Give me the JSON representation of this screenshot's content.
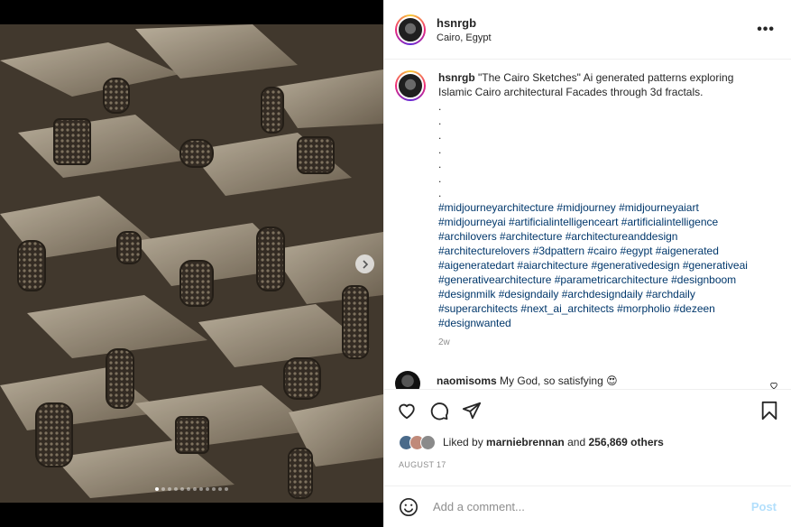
{
  "post": {
    "username": "hsnrgb",
    "location": "Cairo, Egypt",
    "more_icon": "more-horizontal-icon"
  },
  "caption": {
    "username": "hsnrgb",
    "text": "\"The Cairo Sketches\" Ai generated patterns exploring Islamic Cairo architectural Facades through 3d fractals.",
    "dot_lines": [
      ".",
      ".",
      ".",
      ".",
      ".",
      ".",
      "."
    ],
    "hashtags": "#midjourneyarchitecture #midjourney #midjourneyaiart #midjourneyai #artificialintelligenceart #artificialintelligence #archilovers #architecture #architectureanddesign #architecturelovers #3dpattern #cairo #egypt #aigenerated #aigeneratedart #aiarchitecture #generativedesign #generativeai #generativearchitecture #parametricarchitecture #designboom #designmilk #designdaily #archdesigndaily #archdaily #superarchitects #next_ai_architects #morpholio #dezeen #designwanted",
    "time": "2w"
  },
  "comment": {
    "username": "naomisoms",
    "text": "My God, so satisfying 😍"
  },
  "likes": {
    "prefix": "Liked by",
    "user": "marniebrennan",
    "and": "and",
    "others": "256,869 others"
  },
  "date": "AUGUST 17",
  "comment_box": {
    "placeholder": "Add a comment...",
    "post_label": "Post"
  },
  "carousel": {
    "dot_count": 12,
    "active_index": 0
  },
  "colors": {
    "link": "#00376b",
    "post_disabled": "#b2dffc",
    "muted": "#8e8e8e"
  }
}
